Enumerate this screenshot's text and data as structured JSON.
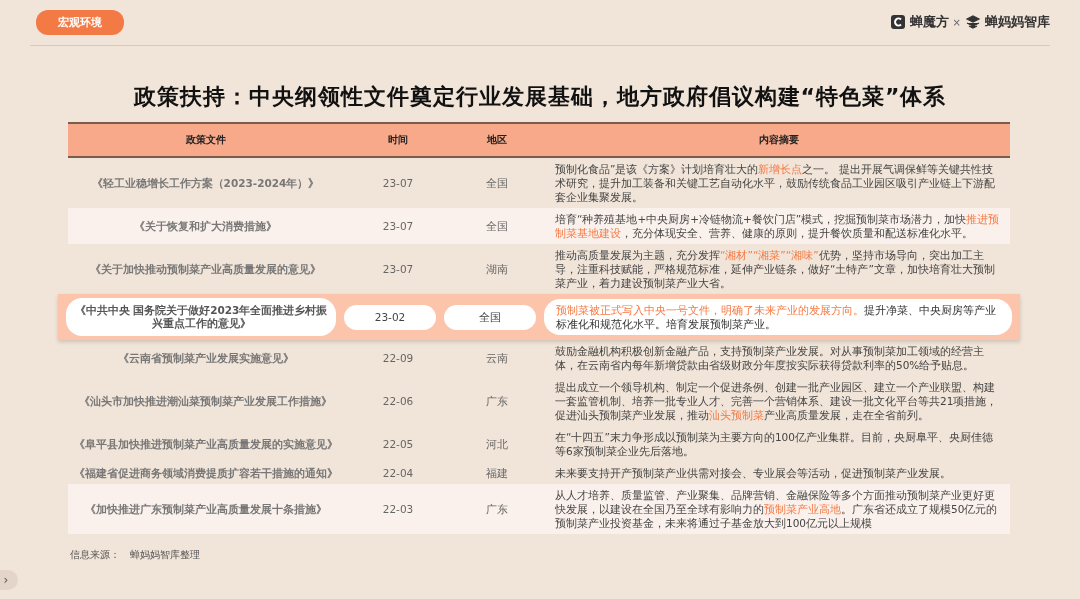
{
  "tag": "宏观环境",
  "brands": [
    "蝉魔方",
    "×",
    "蝉妈妈智库"
  ],
  "title": "政策扶持：中央纲领性文件奠定行业发展基础，地方政府倡议构建“特色菜”体系",
  "table": {
    "columns": [
      "政策文件",
      "时间",
      "地区",
      "内容摘要"
    ],
    "rows": [
      {
        "policy": "《轻工业稳增长工作方案（2023-2024年）》",
        "time": "23-07",
        "region": "全国",
        "shaded": false,
        "selected": false,
        "summary": [
          {
            "text": "预制化食品”是该《方案》计划培育壮大的",
            "highlight": false
          },
          {
            "text": "新增长点",
            "highlight": true
          },
          {
            "text": "之一。 提出开展气调保鲜等关键共性技术研究，提升加工装备和关键工艺自动化水平，鼓励传统食品工业园区吸引产业链上下游配套企业集聚发展。",
            "highlight": false
          }
        ]
      },
      {
        "policy": "《关于恢复和扩大消费措施》",
        "time": "23-07",
        "region": "全国",
        "shaded": true,
        "selected": false,
        "summary": [
          {
            "text": "培育“种养殖基地+中央厨房+冷链物流+餐饮门店”模式，挖掘预制菜市场潜力，加快",
            "highlight": false
          },
          {
            "text": "推进预制菜基地建设",
            "highlight": true
          },
          {
            "text": "，充分体现安全、营养、健康的原则，提升餐饮质量和配送标准化水平。",
            "highlight": false
          }
        ]
      },
      {
        "policy": "《关于加快推动预制菜产业高质量发展的意见》",
        "time": "23-07",
        "region": "湖南",
        "shaded": false,
        "selected": false,
        "summary": [
          {
            "text": "推动高质量发展为主题，充分发挥",
            "highlight": false
          },
          {
            "text": "“湘材”“湘菜”“湘味”",
            "highlight": true
          },
          {
            "text": "优势，坚持市场导向，突出加工主导，注重科技赋能，严格规范标准，延伸产业链条，做好“土特产”文章，加快培育壮大预制菜产业，着力建设预制菜产业大省。",
            "highlight": false
          }
        ]
      },
      {
        "policy": "《中共中央 国务院关于做好2023年全面推进乡村振兴重点工作的意见》",
        "time": "23-02",
        "region": "全国",
        "shaded": false,
        "selected": true,
        "summary": [
          {
            "text": "预制菜被正式写入中央一号文件，明确了未来产业的发展方向。",
            "highlight": true
          },
          {
            "text": "提升净菜、中央厨房等产业标准化和规范化水平。培育发展预制菜产业。",
            "highlight": false
          }
        ]
      },
      {
        "policy": "《云南省预制菜产业发展实施意见》",
        "time": "22-09",
        "region": "云南",
        "shaded": false,
        "selected": false,
        "summary": [
          {
            "text": "鼓励金融机构积极创新金融产品，支持预制菜产业发展。对从事预制菜加工领域的经营主体，在云南省内每年新增贷款由省级财政分年度按实际获得贷款利率的50%给予贴息。",
            "highlight": false
          }
        ]
      },
      {
        "policy": "《汕头市加快推进潮汕菜预制菜产业发展工作措施》",
        "time": "22-06",
        "region": "广东",
        "shaded": false,
        "selected": false,
        "summary": [
          {
            "text": "提出成立一个领导机构、制定一个促进条例、创建一批产业园区、建立一个产业联盟、构建一套监管机制、培养一批专业人才、完善一个营销体系、建设一批文化平台等共21项措施，促进汕头预制菜产业发展，推动",
            "highlight": false
          },
          {
            "text": "汕头预制菜",
            "highlight": true
          },
          {
            "text": "产业高质量发展，走在全省前列。",
            "highlight": false
          }
        ]
      },
      {
        "policy": "《阜平县加快推进预制菜产业高质量发展的实施意见》",
        "time": "22-05",
        "region": "河北",
        "shaded": false,
        "selected": false,
        "summary": [
          {
            "text": "在“十四五”末力争形成以预制菜为主要方向的100亿产业集群。目前，央厨阜平、央厨佳德等6家预制菜企业先后落地。",
            "highlight": false
          }
        ]
      },
      {
        "policy": "《福建省促进商务领域消费提质扩容若干措施的通知》",
        "time": "22-04",
        "region": "福建",
        "shaded": false,
        "selected": false,
        "summary": [
          {
            "text": "未来要支持开产预制菜产业供需对接会、专业展会等活动，促进预制菜产业发展。",
            "highlight": false
          }
        ]
      },
      {
        "policy": "《加快推进广东预制菜产业高质量发展十条措施》",
        "time": "22-03",
        "region": "广东",
        "shaded": true,
        "selected": false,
        "summary": [
          {
            "text": "从人才培养、质量监管、产业聚集、品牌营销、金融保险等多个方面推动预制菜产业更好更快发展，以建设在全国乃至全球有影响力的",
            "highlight": false
          },
          {
            "text": "预制菜产业高地",
            "highlight": true
          },
          {
            "text": "。广东省还成立了规模50亿元的预制菜产业投资基金，未来将通过子基金放大到100亿元以上规模",
            "highlight": false
          }
        ]
      }
    ]
  },
  "source": [
    "信息来源：",
    "蝉妈妈智库整理"
  ],
  "side_tab": "›"
}
